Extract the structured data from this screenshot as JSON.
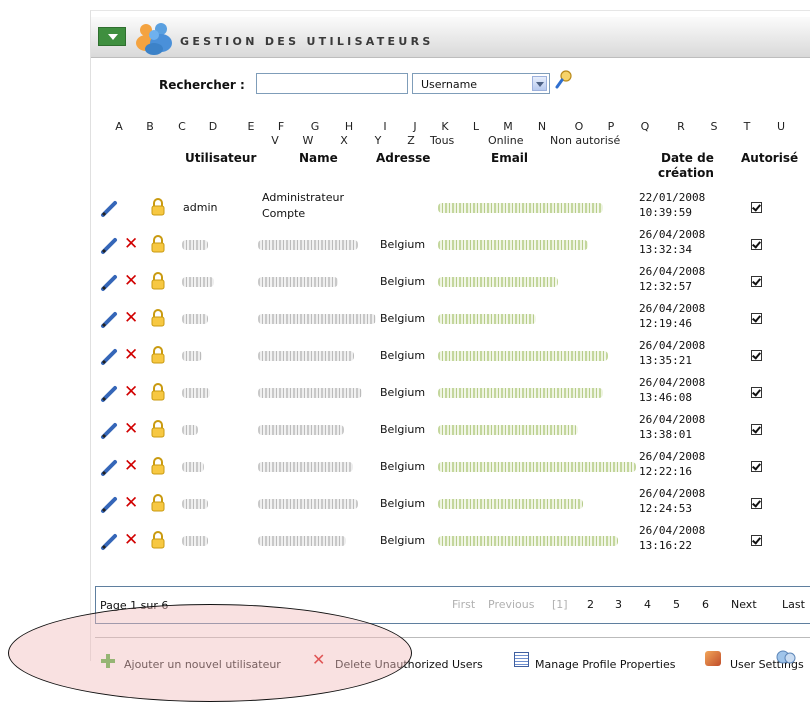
{
  "header": {
    "title": "GESTION DES UTILISATEURS"
  },
  "search": {
    "label": "Rechercher :",
    "value": "",
    "field_selected": "Username"
  },
  "letters_row1": [
    "A",
    "B",
    "C",
    "D",
    "E",
    "F",
    "G",
    "H",
    "I",
    "J",
    "K",
    "L",
    "M",
    "N",
    "O",
    "P",
    "Q",
    "R",
    "S",
    "T",
    "U"
  ],
  "letters_row2": [
    "V",
    "W",
    "X",
    "Y",
    "Z",
    "Tous",
    "Online",
    "Non autorisé"
  ],
  "columns": {
    "user": "Utilisateur",
    "name": "Name",
    "address": "Adresse",
    "email": "Email",
    "date_line1": "Date de",
    "date_line2": "création",
    "authorized": "Autorisé"
  },
  "rows": [
    {
      "username": "admin",
      "name_line1": "Administrateur",
      "name_line2": "Compte",
      "address": "",
      "date": "22/01/2008",
      "time": "10:39:59",
      "authorized": true
    },
    {
      "username": "",
      "address": "Belgium",
      "date": "26/04/2008",
      "time": "13:32:34",
      "authorized": true
    },
    {
      "username": "",
      "address": "Belgium",
      "date": "26/04/2008",
      "time": "12:32:57",
      "authorized": true
    },
    {
      "username": "",
      "address": "Belgium",
      "date": "26/04/2008",
      "time": "12:19:46",
      "authorized": true
    },
    {
      "username": "",
      "address": "Belgium",
      "date": "26/04/2008",
      "time": "13:35:21",
      "authorized": true
    },
    {
      "username": "",
      "address": "Belgium",
      "date": "26/04/2008",
      "time": "13:46:08",
      "authorized": true
    },
    {
      "username": "",
      "address": "Belgium",
      "date": "26/04/2008",
      "time": "13:38:01",
      "authorized": true
    },
    {
      "username": "",
      "address": "Belgium",
      "date": "26/04/2008",
      "time": "12:22:16",
      "authorized": true
    },
    {
      "username": "",
      "address": "Belgium",
      "date": "26/04/2008",
      "time": "12:24:53",
      "authorized": true
    },
    {
      "username": "",
      "address": "Belgium",
      "date": "26/04/2008",
      "time": "13:16:22",
      "authorized": true
    }
  ],
  "pager": {
    "info": "Page 1 sur 6",
    "first": "First",
    "previous": "Previous",
    "current": "[1]",
    "pages": [
      "2",
      "3",
      "4",
      "5",
      "6"
    ],
    "next": "Next",
    "last": "Last"
  },
  "footer": {
    "add_user": "Ajouter un nouvel utilisateur",
    "delete_unauthorized": "Delete Unauthorized Users",
    "manage_profile": "Manage Profile Properties",
    "user_settings": "User Settings"
  },
  "colors": {
    "delete": "#d10000",
    "highlight": "#f2bcbc",
    "header_green": "#3f8f3f"
  }
}
